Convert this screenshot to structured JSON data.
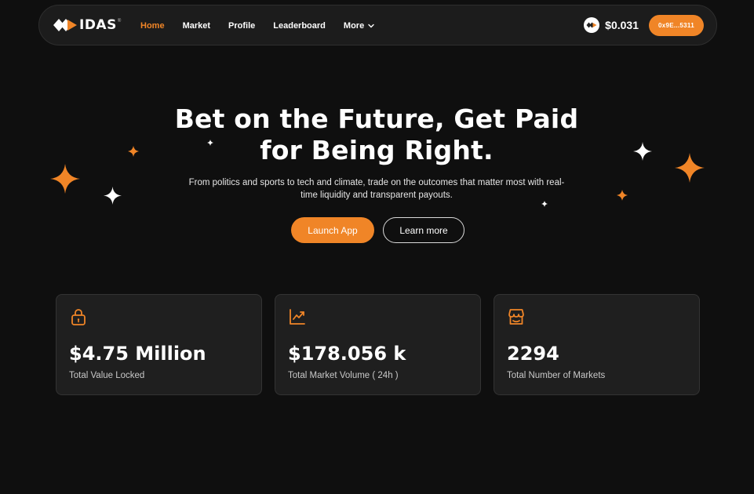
{
  "nav": {
    "logo_text": "IDAS",
    "logo_reg": "®",
    "links": [
      "Home",
      "Market",
      "Profile",
      "Leaderboard",
      "More"
    ],
    "active_link": "Home",
    "price": "$0.031",
    "wallet": "0x9E...5311"
  },
  "hero": {
    "title_line1": "Bet on the Future, Get Paid",
    "title_line2": "for Being Right.",
    "subtitle": "From politics and sports to tech and climate, trade on the outcomes that matter most with real-time liquidity and transparent payouts.",
    "primary_button": "Launch App",
    "secondary_button": "Learn more"
  },
  "stats": [
    {
      "icon": "lock-icon",
      "value": "$4.75 Million",
      "label": "Total Value Locked"
    },
    {
      "icon": "trending-up-icon",
      "value": "$178.056 k",
      "label": "Total Market Volume ( 24h )"
    },
    {
      "icon": "storefront-icon",
      "value": "2294",
      "label": "Total Number of Markets"
    }
  ],
  "colors": {
    "accent": "#f08527",
    "background": "#0f0f0f",
    "card": "#1f1f1f",
    "navbar": "#1c1c1c"
  }
}
